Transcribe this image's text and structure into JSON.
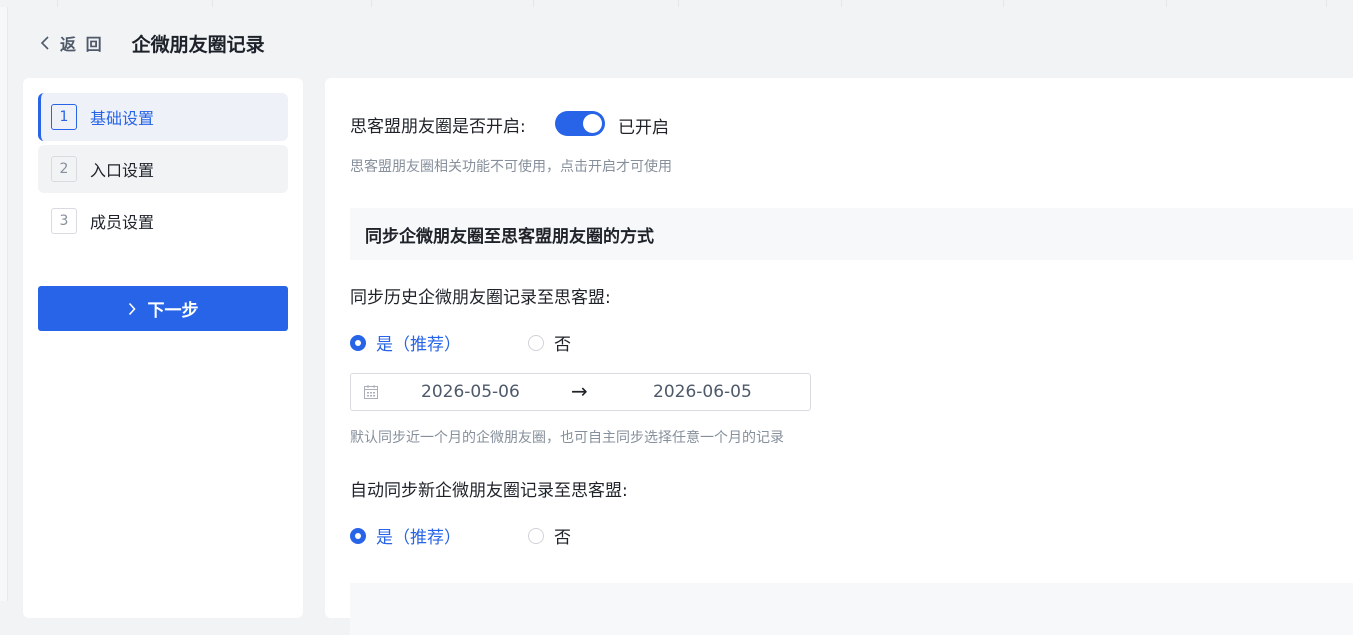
{
  "header": {
    "back_label": "返 回",
    "title": "企微朋友圈记录"
  },
  "steps": [
    {
      "num": "1",
      "label": "基础设置"
    },
    {
      "num": "2",
      "label": "入口设置"
    },
    {
      "num": "3",
      "label": "成员设置"
    }
  ],
  "next_button": "下一步",
  "toggle": {
    "label": "思客盟朋友圈是否开启:",
    "state_label": "已开启",
    "on": true,
    "hint": "思客盟朋友圈相关功能不可使用，点击开启才可使用"
  },
  "section_sync": {
    "title": "同步企微朋友圈至思客盟朋友圈的方式"
  },
  "history_sync": {
    "label": "同步历史企微朋友圈记录至思客盟:",
    "option_yes": "是（推荐）",
    "option_no": "否",
    "selected": "yes",
    "date_start": "2026-05-06",
    "date_end": "2026-06-05",
    "arrow": "→",
    "hint": "默认同步近一个月的企微朋友圈，也可自主同步选择任意一个月的记录"
  },
  "auto_sync": {
    "label": "自动同步新企微朋友圈记录至思客盟:",
    "option_yes": "是（推荐）",
    "option_no": "否",
    "selected": "yes"
  },
  "colors": {
    "accent": "#2764e8",
    "background": "#f2f3f5",
    "panel": "#ffffff",
    "hint_text": "#86909c"
  }
}
